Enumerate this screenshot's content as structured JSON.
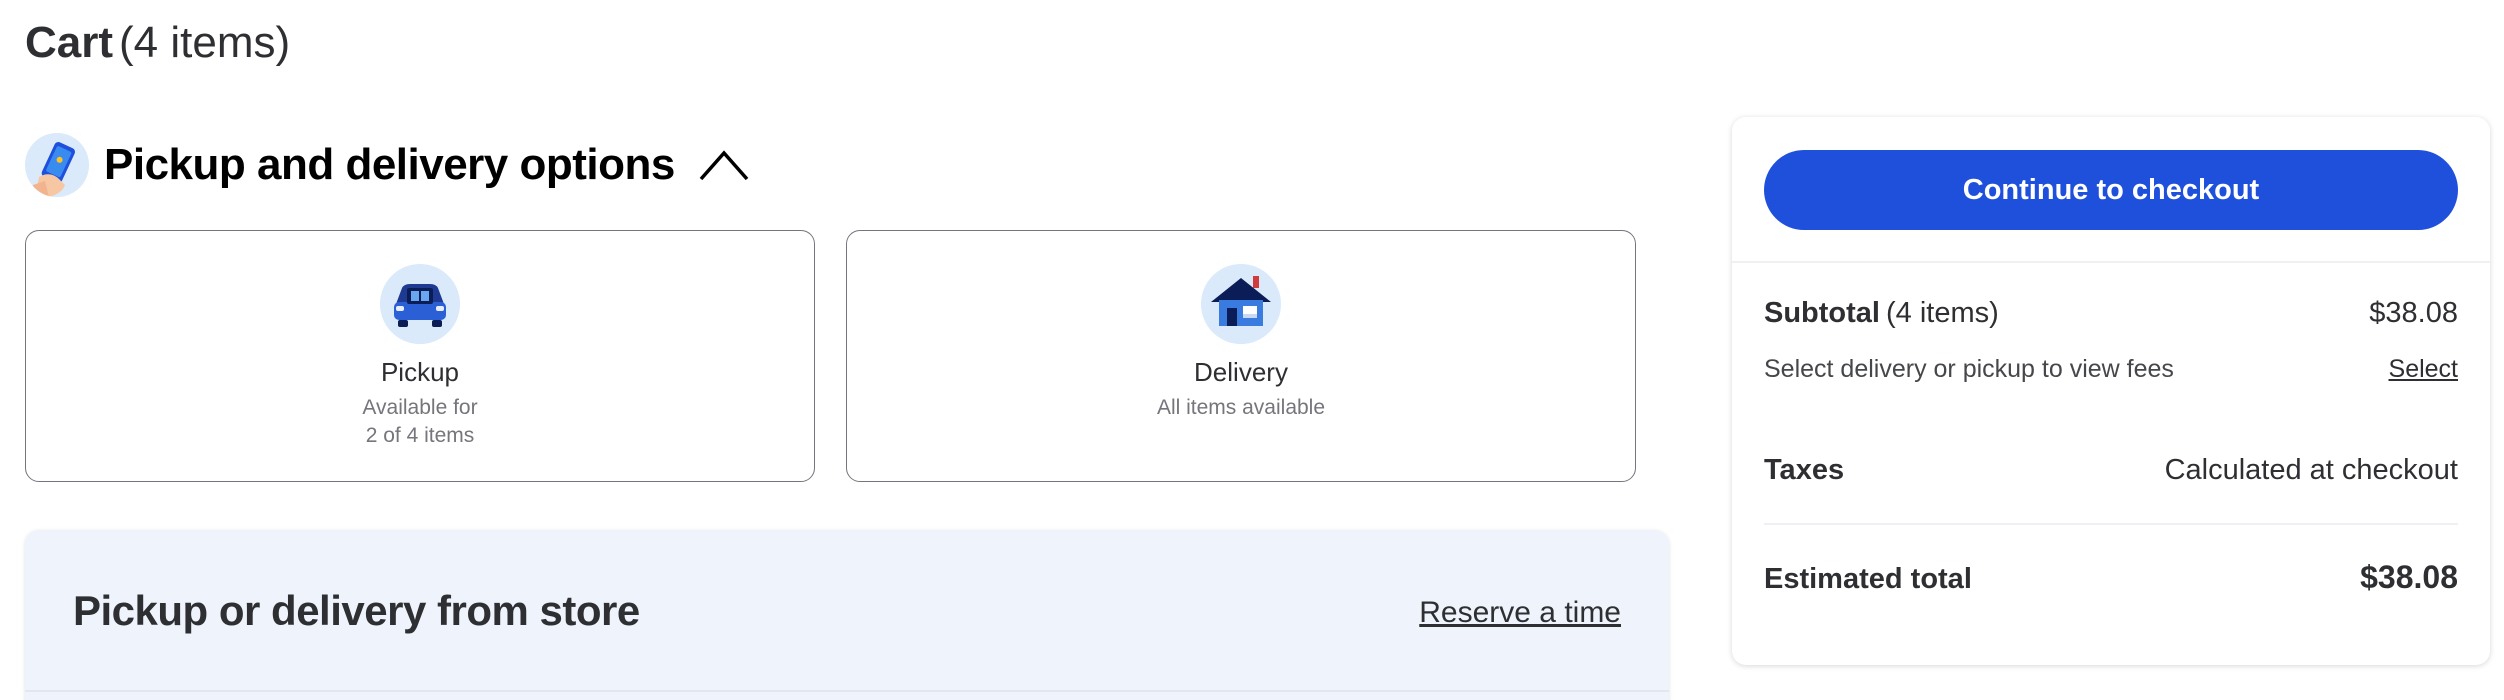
{
  "cart": {
    "title": "Cart",
    "count_text": "(4 items)"
  },
  "options_section": {
    "title": "Pickup and delivery options",
    "icon": "phone-in-hand-icon",
    "toggle_icon": "chevron-up-icon"
  },
  "pickup": {
    "icon": "car-trunk-icon",
    "title": "Pickup",
    "subtitle_line1": "Available for",
    "subtitle_line2": "2 of 4 items"
  },
  "delivery": {
    "icon": "house-icon",
    "title": "Delivery",
    "subtitle": "All items available"
  },
  "store_panel": {
    "title": "Pickup or delivery from store",
    "link": "Reserve a time"
  },
  "summary": {
    "checkout_button": "Continue to checkout",
    "subtotal_label": "Subtotal",
    "subtotal_count": "(4 items)",
    "subtotal_value": "$38.08",
    "fees_text": "Select delivery or pickup to view fees",
    "fees_link": "Select",
    "taxes_label": "Taxes",
    "taxes_value": "Calculated at checkout",
    "total_label": "Estimated total",
    "total_value": "$38.08"
  },
  "colors": {
    "primary_button": "#1e50dc",
    "icon_circle": "#dbeafb",
    "panel_bg": "#eff4fc",
    "text": "#2e2f32",
    "muted": "#74767c"
  }
}
